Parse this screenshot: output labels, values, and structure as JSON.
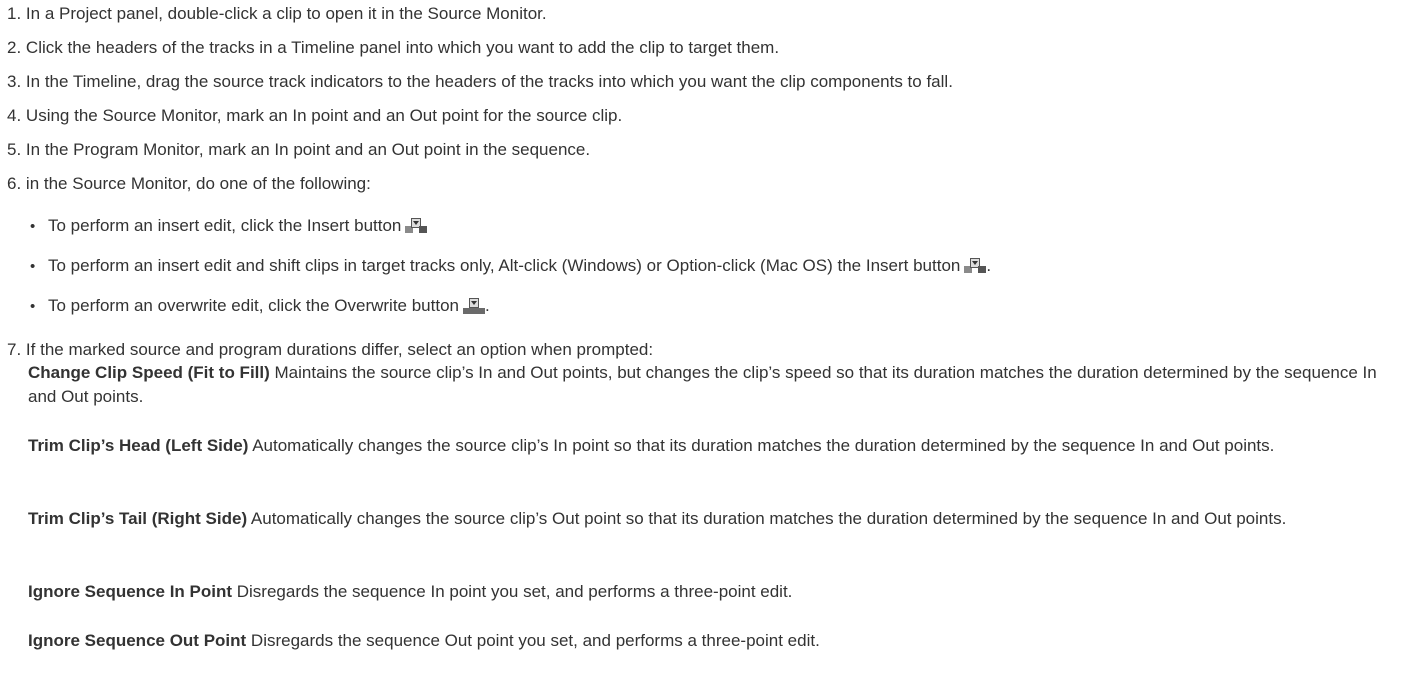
{
  "steps": [
    {
      "num": "1.",
      "text": "In a Project panel, double-click a clip to open it in the Source Monitor."
    },
    {
      "num": "2.",
      "text": "Click the headers of the tracks in a Timeline panel into which you want to add the clip to target them."
    },
    {
      "num": "3.",
      "text": "In the Timeline, drag the source track indicators to the headers of the tracks into which you want the clip components to fall."
    },
    {
      "num": "4.",
      "text": "Using the Source Monitor, mark an In point and an Out point for the source clip."
    },
    {
      "num": "5.",
      "text": "In the Program Monitor, mark an In point and an Out point in the sequence."
    },
    {
      "num": "6.",
      "text": "in the Source Monitor, do one of the following:"
    },
    {
      "num": "7.",
      "text": "If the marked source and program durations differ, select an option when prompted:"
    }
  ],
  "bullets": [
    {
      "text": "To perform an insert edit, click the Insert button",
      "icon": "insert-icon",
      "suffix": ""
    },
    {
      "text": "To perform an insert edit and shift clips in target tracks only, Alt-click (Windows) or Option-click (Mac OS) the Insert button",
      "icon": "insert-icon",
      "suffix": "."
    },
    {
      "text": "To perform an overwrite edit, click the Overwrite button",
      "icon": "overwrite-icon",
      "suffix": "."
    }
  ],
  "options": [
    {
      "term": "Change Clip Speed (Fit to Fill)",
      "desc": " Maintains the source clip’s In and Out points, but changes the clip’s speed so that its duration matches the duration determined by the sequence In and Out points."
    },
    {
      "term": "Trim Clip’s Head (Left Side)",
      "desc": " Automatically changes the source clip’s In point so that its duration matches the duration determined by the sequence In and Out points."
    },
    {
      "term": "Trim Clip’s Tail (Right Side)",
      "desc": " Automatically changes the source clip’s Out point so that its duration matches the duration determined by the sequence In and Out points."
    },
    {
      "term": "Ignore Sequence In Point",
      "desc": " Disregards the sequence In point you set, and performs a three-point edit."
    },
    {
      "term": "Ignore Sequence Out Point",
      "desc": " Disregards the sequence Out point you set, and performs a three-point edit."
    }
  ],
  "bullet_char": "•"
}
